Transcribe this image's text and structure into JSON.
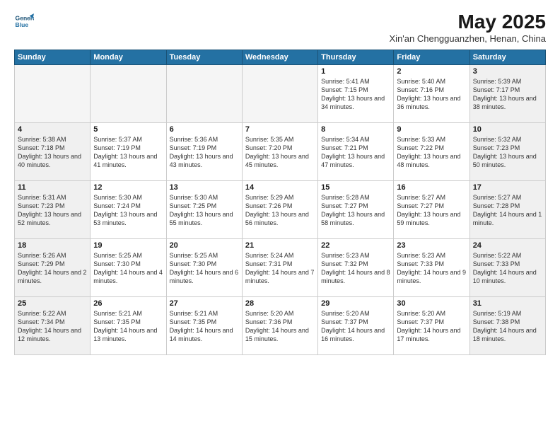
{
  "header": {
    "logo_line1": "General",
    "logo_line2": "Blue",
    "month_year": "May 2025",
    "location": "Xin'an Chengguanzhen, Henan, China"
  },
  "weekdays": [
    "Sunday",
    "Monday",
    "Tuesday",
    "Wednesday",
    "Thursday",
    "Friday",
    "Saturday"
  ],
  "weeks": [
    [
      {
        "day": "",
        "empty": true
      },
      {
        "day": "",
        "empty": true
      },
      {
        "day": "",
        "empty": true
      },
      {
        "day": "",
        "empty": true
      },
      {
        "day": "1",
        "rise": "5:41 AM",
        "set": "7:15 PM",
        "daylight": "13 hours and 34 minutes."
      },
      {
        "day": "2",
        "rise": "5:40 AM",
        "set": "7:16 PM",
        "daylight": "13 hours and 36 minutes."
      },
      {
        "day": "3",
        "rise": "5:39 AM",
        "set": "7:17 PM",
        "daylight": "13 hours and 38 minutes."
      }
    ],
    [
      {
        "day": "4",
        "rise": "5:38 AM",
        "set": "7:18 PM",
        "daylight": "13 hours and 40 minutes."
      },
      {
        "day": "5",
        "rise": "5:37 AM",
        "set": "7:19 PM",
        "daylight": "13 hours and 41 minutes."
      },
      {
        "day": "6",
        "rise": "5:36 AM",
        "set": "7:19 PM",
        "daylight": "13 hours and 43 minutes."
      },
      {
        "day": "7",
        "rise": "5:35 AM",
        "set": "7:20 PM",
        "daylight": "13 hours and 45 minutes."
      },
      {
        "day": "8",
        "rise": "5:34 AM",
        "set": "7:21 PM",
        "daylight": "13 hours and 47 minutes."
      },
      {
        "day": "9",
        "rise": "5:33 AM",
        "set": "7:22 PM",
        "daylight": "13 hours and 48 minutes."
      },
      {
        "day": "10",
        "rise": "5:32 AM",
        "set": "7:23 PM",
        "daylight": "13 hours and 50 minutes."
      }
    ],
    [
      {
        "day": "11",
        "rise": "5:31 AM",
        "set": "7:23 PM",
        "daylight": "13 hours and 52 minutes."
      },
      {
        "day": "12",
        "rise": "5:30 AM",
        "set": "7:24 PM",
        "daylight": "13 hours and 53 minutes."
      },
      {
        "day": "13",
        "rise": "5:30 AM",
        "set": "7:25 PM",
        "daylight": "13 hours and 55 minutes."
      },
      {
        "day": "14",
        "rise": "5:29 AM",
        "set": "7:26 PM",
        "daylight": "13 hours and 56 minutes."
      },
      {
        "day": "15",
        "rise": "5:28 AM",
        "set": "7:27 PM",
        "daylight": "13 hours and 58 minutes."
      },
      {
        "day": "16",
        "rise": "5:27 AM",
        "set": "7:27 PM",
        "daylight": "13 hours and 59 minutes."
      },
      {
        "day": "17",
        "rise": "5:27 AM",
        "set": "7:28 PM",
        "daylight": "14 hours and 1 minute."
      }
    ],
    [
      {
        "day": "18",
        "rise": "5:26 AM",
        "set": "7:29 PM",
        "daylight": "14 hours and 2 minutes."
      },
      {
        "day": "19",
        "rise": "5:25 AM",
        "set": "7:30 PM",
        "daylight": "14 hours and 4 minutes."
      },
      {
        "day": "20",
        "rise": "5:25 AM",
        "set": "7:30 PM",
        "daylight": "14 hours and 6 minutes."
      },
      {
        "day": "21",
        "rise": "5:24 AM",
        "set": "7:31 PM",
        "daylight": "14 hours and 7 minutes."
      },
      {
        "day": "22",
        "rise": "5:23 AM",
        "set": "7:32 PM",
        "daylight": "14 hours and 8 minutes."
      },
      {
        "day": "23",
        "rise": "5:23 AM",
        "set": "7:33 PM",
        "daylight": "14 hours and 9 minutes."
      },
      {
        "day": "24",
        "rise": "5:22 AM",
        "set": "7:33 PM",
        "daylight": "14 hours and 10 minutes."
      }
    ],
    [
      {
        "day": "25",
        "rise": "5:22 AM",
        "set": "7:34 PM",
        "daylight": "14 hours and 12 minutes."
      },
      {
        "day": "26",
        "rise": "5:21 AM",
        "set": "7:35 PM",
        "daylight": "14 hours and 13 minutes."
      },
      {
        "day": "27",
        "rise": "5:21 AM",
        "set": "7:35 PM",
        "daylight": "14 hours and 14 minutes."
      },
      {
        "day": "28",
        "rise": "5:20 AM",
        "set": "7:36 PM",
        "daylight": "14 hours and 15 minutes."
      },
      {
        "day": "29",
        "rise": "5:20 AM",
        "set": "7:37 PM",
        "daylight": "14 hours and 16 minutes."
      },
      {
        "day": "30",
        "rise": "5:20 AM",
        "set": "7:37 PM",
        "daylight": "14 hours and 17 minutes."
      },
      {
        "day": "31",
        "rise": "5:19 AM",
        "set": "7:38 PM",
        "daylight": "14 hours and 18 minutes."
      }
    ]
  ]
}
